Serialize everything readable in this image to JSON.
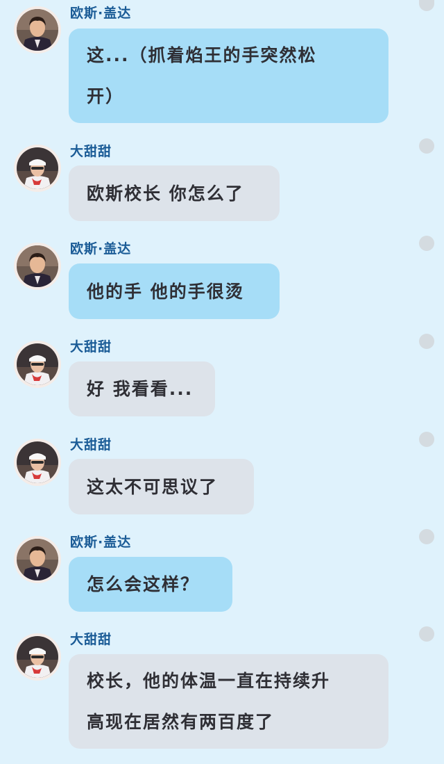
{
  "conversation": {
    "messages": [
      {
        "sender": "欧斯·盖达",
        "text": "这...（抓着焰王的手突然松\n开）",
        "avatar": "man-in-suit-avatar",
        "bubble_color": "#a6ddf7"
      },
      {
        "sender": "大甜甜",
        "text": "欧斯校长 你怎么了",
        "avatar": "nurse-avatar",
        "bubble_color": "#dde3ea"
      },
      {
        "sender": "欧斯·盖达",
        "text": "他的手 他的手很烫",
        "avatar": "man-in-suit-avatar",
        "bubble_color": "#a6ddf7"
      },
      {
        "sender": "大甜甜",
        "text": "好 我看看...",
        "avatar": "nurse-avatar",
        "bubble_color": "#dde3ea"
      },
      {
        "sender": "大甜甜",
        "text": "这太不可思议了",
        "avatar": "nurse-avatar",
        "bubble_color": "#dde3ea"
      },
      {
        "sender": "欧斯·盖达",
        "text": "怎么会这样？",
        "avatar": "man-in-suit-avatar",
        "bubble_color": "#a6ddf7"
      },
      {
        "sender": "大甜甜",
        "text": "校长，他的体温一直在持续升\n高现在居然有两百度了",
        "avatar": "nurse-avatar",
        "bubble_color": "#dde3ea"
      }
    ]
  }
}
